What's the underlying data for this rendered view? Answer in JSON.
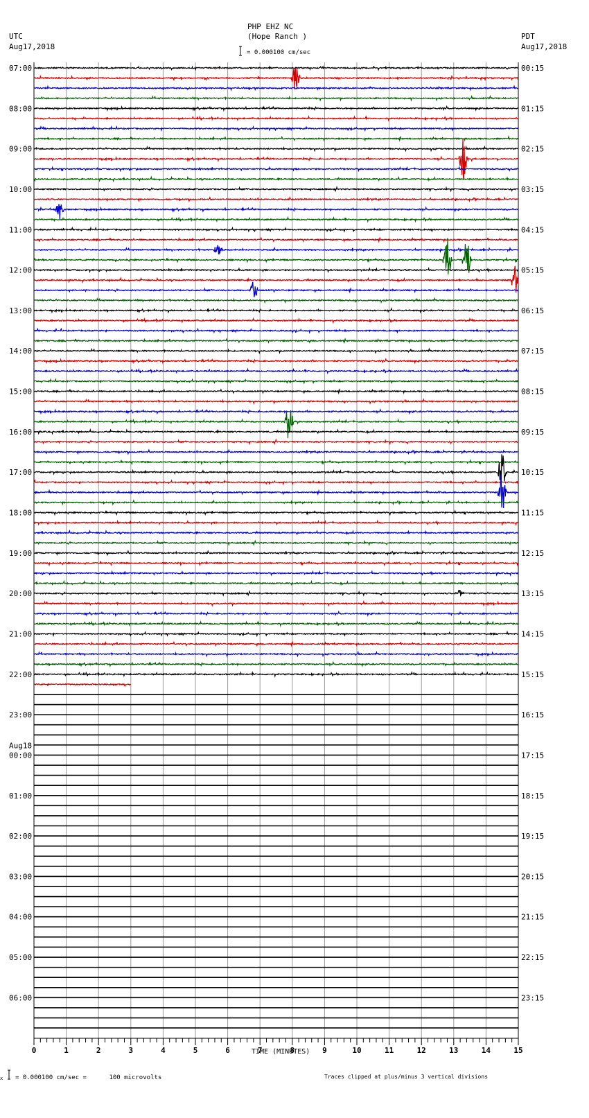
{
  "header": {
    "station": "PHP EHZ NC",
    "location": "(Hope Ranch )",
    "left_tz": "UTC",
    "left_date": "Aug17,2018",
    "right_tz": "PDT",
    "right_date": "Aug17,2018",
    "scale": "= 0.000100 cm/sec"
  },
  "footer": {
    "scale": "= 0.000100 cm/sec =      100 microvolts",
    "scale_prefix": "x",
    "clip_note": "Traces clipped at plus/minus 3 vertical divisions"
  },
  "chart_data": {
    "type": "line",
    "title": "PHP EHZ NC (Hope Ranch )",
    "xlabel": "TIME (MINUTES)",
    "xlim": [
      0,
      15
    ],
    "xticks": [
      "0",
      "1",
      "2",
      "3",
      "4",
      "5",
      "6",
      "7",
      "8",
      "9",
      "10",
      "11",
      "12",
      "13",
      "14",
      "15"
    ],
    "rows_total": 96,
    "rows_per_hour": 4,
    "full_data_rows": 61,
    "partial_row_minutes": 3,
    "trace_colors": [
      "#000000",
      "#d00000",
      "#0000d0",
      "#006000"
    ],
    "left_labels": [
      "07:00",
      "08:00",
      "09:00",
      "10:00",
      "11:00",
      "12:00",
      "13:00",
      "14:00",
      "15:00",
      "16:00",
      "17:00",
      "18:00",
      "19:00",
      "20:00",
      "21:00",
      "22:00",
      "23:00",
      "00:00",
      "01:00",
      "02:00",
      "03:00",
      "04:00",
      "05:00",
      "06:00"
    ],
    "left_date_change": {
      "hour_index": 17,
      "label": "Aug18"
    },
    "right_labels": [
      "00:15",
      "01:15",
      "02:15",
      "03:15",
      "04:15",
      "05:15",
      "06:15",
      "07:15",
      "08:15",
      "09:15",
      "10:15",
      "11:15",
      "12:15",
      "13:15",
      "14:15",
      "15:15",
      "16:15",
      "17:15",
      "18:15",
      "19:15",
      "20:15",
      "21:15",
      "22:15",
      "23:15"
    ],
    "events": [
      {
        "row": 1,
        "minute": 8.1,
        "amp": 2
      },
      {
        "row": 9,
        "minute": 13.3,
        "amp": 3
      },
      {
        "row": 14,
        "minute": 0.8,
        "amp": 1.2
      },
      {
        "row": 18,
        "minute": 5.7,
        "amp": 1
      },
      {
        "row": 19,
        "minute": 12.8,
        "amp": 3
      },
      {
        "row": 19,
        "minute": 13.4,
        "amp": 3
      },
      {
        "row": 21,
        "minute": 14.9,
        "amp": 2
      },
      {
        "row": 22,
        "minute": 6.8,
        "amp": 1.5
      },
      {
        "row": 35,
        "minute": 7.9,
        "amp": 3
      },
      {
        "row": 40,
        "minute": 14.5,
        "amp": 3
      },
      {
        "row": 42,
        "minute": 14.5,
        "amp": 3
      },
      {
        "row": 52,
        "minute": 13.2,
        "amp": 0.6
      }
    ]
  }
}
